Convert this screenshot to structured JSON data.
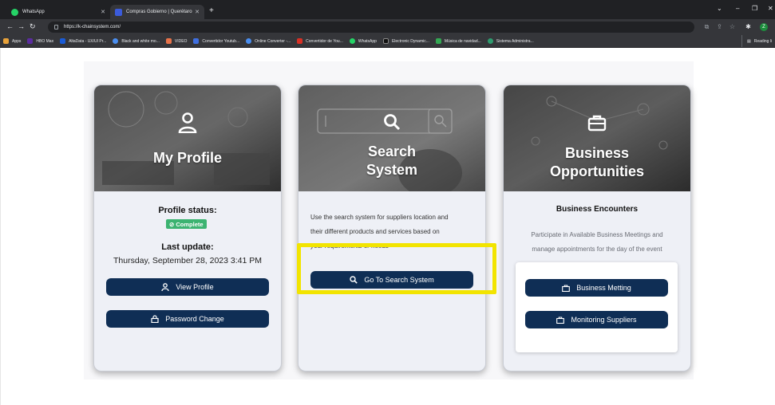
{
  "browser": {
    "tabs": [
      {
        "title": "WhatsApp",
        "active": false
      },
      {
        "title": "Compras Gobierno | Querétaro",
        "active": true
      }
    ],
    "url": "https://k-chainsystem.com/",
    "bookmarks": [
      "Apps",
      "HBO Max",
      "AltaData - UX/UI Pr...",
      "Black and white mo...",
      "VIDEO",
      "Convertidor Youtub...",
      "Online Converter -...",
      "Convertidor de You...",
      "WhatsApp",
      "Electronic Dynamic...",
      "Música de navidad...",
      "Sistema Administra..."
    ],
    "reading_list": "Reading li",
    "profile_initial": "Z"
  },
  "cards": {
    "profile": {
      "title": "My Profile",
      "status_label": "Profile status:",
      "status_badge": "⊘ Complete",
      "last_update_label": "Last update:",
      "last_update_value": "Thursday, September 28, 2023 3:41 PM",
      "view_button": "View Profile",
      "password_button": "Password Change"
    },
    "search": {
      "title_line1": "Search",
      "title_line2": "System",
      "desc_line1": "Use the search system for suppliers location and",
      "desc_line2": "their different products and services based on",
      "desc_line3": "your requirements or needs",
      "button": "Go To Search System"
    },
    "business": {
      "title_line1": "Business",
      "title_line2": "Opportunities",
      "subtitle": "Business Encounters",
      "desc_line1": "Participate in Available Business Meetings and",
      "desc_line2": "manage appointments for the day of the event",
      "meeting_button": "Business Metting",
      "monitor_button": "Monitoring Suppliers"
    }
  },
  "colors": {
    "button": "#0f2e55",
    "badge": "#3cb371",
    "highlight": "#f2e400",
    "card_bg": "#eef0f6"
  }
}
